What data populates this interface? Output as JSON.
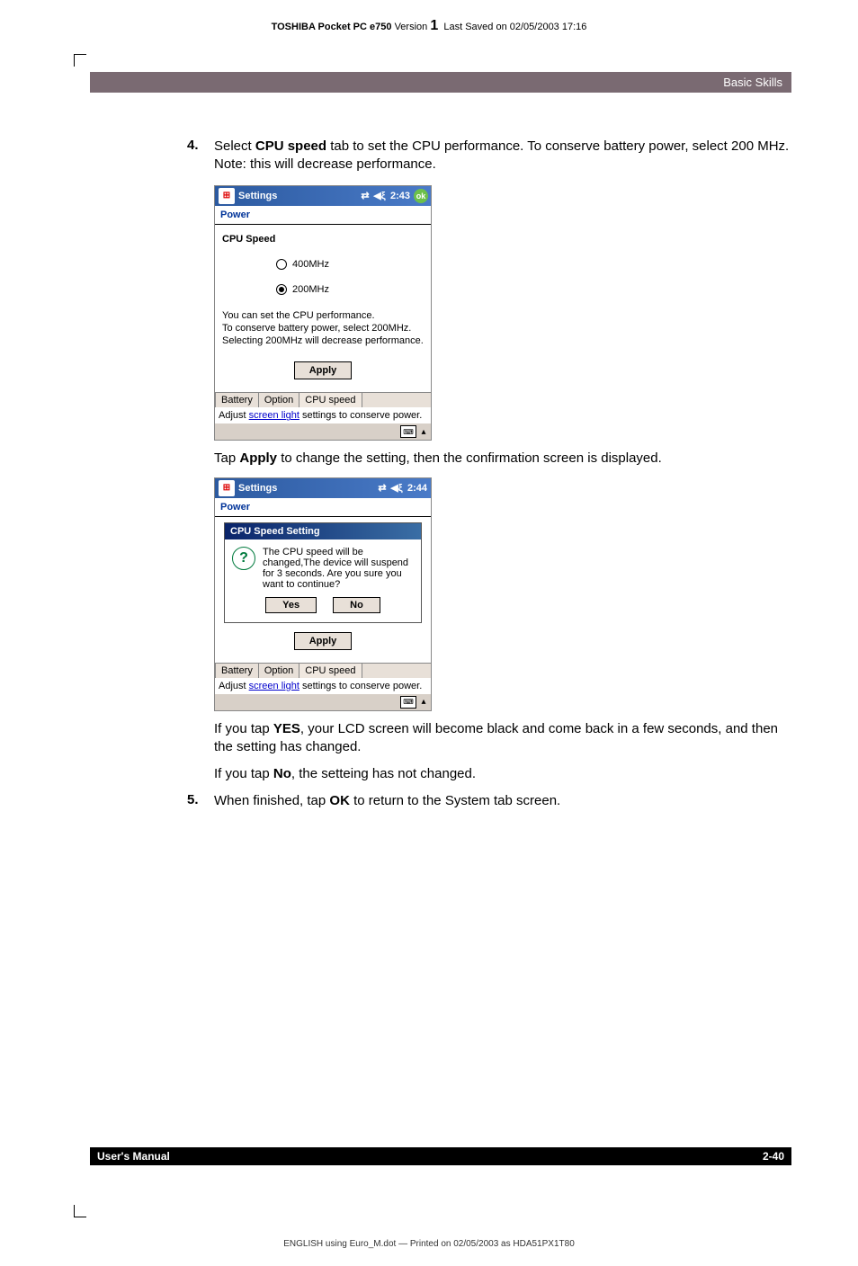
{
  "header": {
    "product": "TOSHIBA Pocket PC e750",
    "version_label": "Version",
    "version_num": "1",
    "saved": "Last Saved on 02/05/2003 17:16"
  },
  "section_bar": "Basic Skills",
  "step4": {
    "num": "4.",
    "text_prefix": "Select ",
    "bold1": "CPU speed",
    "text_suffix": " tab to set the CPU performance. To conserve battery power, select 200 MHz. Note: this will decrease performance."
  },
  "shot1": {
    "titlebar": {
      "title": "Settings",
      "time": "2:43",
      "ok": "ok"
    },
    "subtitle": "Power",
    "heading": "CPU Speed",
    "radio1": "400MHz",
    "radio2": "200MHz",
    "info": "You can set the CPU performance.\nTo conserve battery power, select 200MHz.\nSelecting 200MHz will decrease performance.",
    "apply": "Apply",
    "tabs": {
      "t1": "Battery",
      "t2": "Option",
      "t3": "CPU speed"
    },
    "hint_pre": "Adjust ",
    "hint_link": "screen light",
    "hint_post": " settings to conserve power."
  },
  "mid_text": {
    "pre": "Tap ",
    "bold": "Apply",
    "post": " to change the setting, then the confirmation screen is displayed."
  },
  "shot2": {
    "titlebar": {
      "title": "Settings",
      "time": "2:44"
    },
    "subtitle": "Power",
    "dialog": {
      "title": "CPU Speed Setting",
      "body": "The CPU speed will be changed,The device will suspend for 3 seconds. Are you sure you want to continue?",
      "yes": "Yes",
      "no": "No"
    },
    "apply": "Apply",
    "tabs": {
      "t1": "Battery",
      "t2": "Option",
      "t3": "CPU speed"
    },
    "hint_pre": "Adjust ",
    "hint_link": "screen light",
    "hint_post": " settings to conserve power."
  },
  "after1": {
    "pre": "If you tap ",
    "bold": "YES",
    "post": ", your LCD screen will become black and come back in a few seconds, and then the setting has changed."
  },
  "after2": {
    "pre": "If you tap ",
    "bold": "No",
    "post": ", the setteing has not changed."
  },
  "step5": {
    "num": "5.",
    "pre": "When finished, tap ",
    "bold": "OK",
    "post": " to return to the System tab screen."
  },
  "footer": {
    "left": "User's Manual",
    "right": "2-40"
  },
  "footer_print": "ENGLISH using Euro_M.dot — Printed on 02/05/2003 as HDA51PX1T80"
}
